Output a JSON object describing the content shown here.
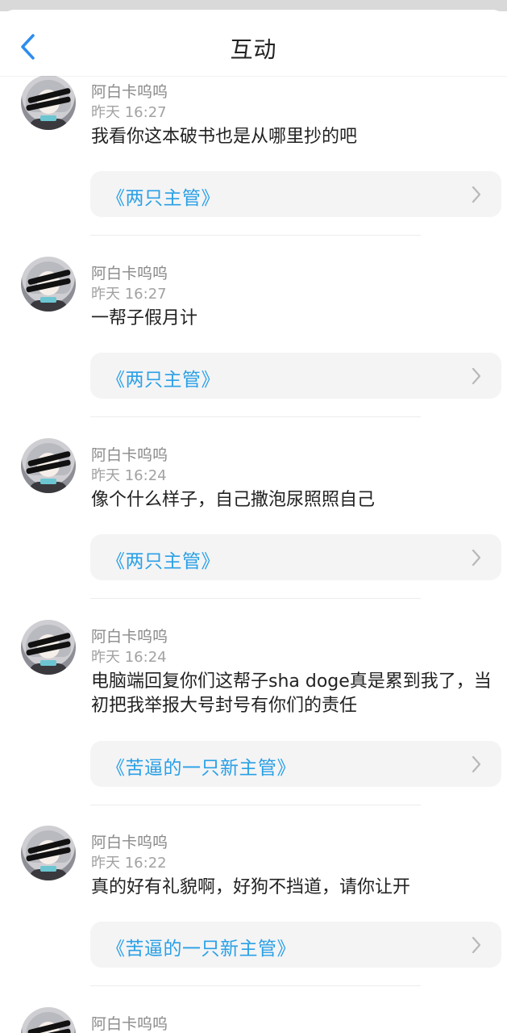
{
  "header": {
    "title": "互动",
    "back_icon": "chevron-left-icon"
  },
  "colors": {
    "link": "#2aa0e6",
    "back_accent": "#2d8cf0",
    "card_bg": "#f4f4f5"
  },
  "items": [
    {
      "name": "阿白卡呜呜",
      "time": "昨天 16:27",
      "text": "我看你这本破书也是从哪里抄的吧",
      "book": "《两只主管》"
    },
    {
      "name": "阿白卡呜呜",
      "time": "昨天 16:27",
      "text": "一帮子假月计",
      "book": "《两只主管》"
    },
    {
      "name": "阿白卡呜呜",
      "time": "昨天 16:24",
      "text": "像个什么样子，自己撒泡尿照照自己",
      "book": "《两只主管》"
    },
    {
      "name": "阿白卡呜呜",
      "time": "昨天 16:24",
      "text": "电脑端回复你们这帮子sha doge真是累到我了，当初把我举报大号封号有你们的责任",
      "book": "《苦逼的一只新主管》"
    },
    {
      "name": "阿白卡呜呜",
      "time": "昨天 16:22",
      "text": "真的好有礼貌啊，好狗不挡道，请你让开",
      "book": "《苦逼的一只新主管》"
    },
    {
      "name": "阿白卡呜呜"
    }
  ]
}
